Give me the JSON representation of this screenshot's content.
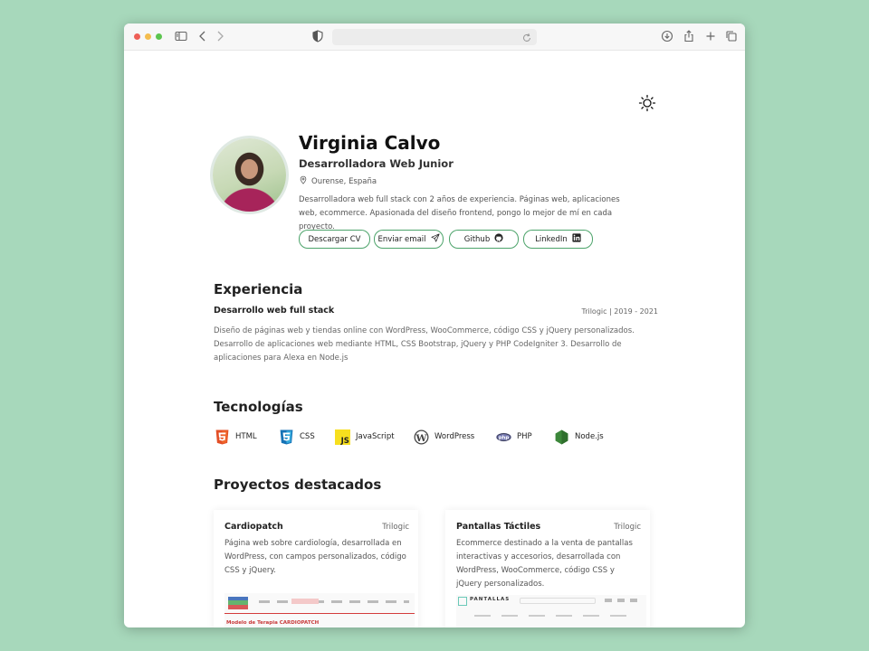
{
  "profile": {
    "name": "Virginia Calvo",
    "role": "Desarrolladora Web Junior",
    "location": "Ourense, España",
    "bio": "Desarrolladora web full stack con 2 años de experiencia. Páginas web, aplicaciones web, ecommerce. Apasionada del diseño frontend, pongo lo mejor de mí en cada proyecto."
  },
  "buttons": {
    "cv": "Descargar CV",
    "email": "Enviar email",
    "github": "Github",
    "linkedin": "LinkedIn"
  },
  "experience": {
    "heading": "Experiencia",
    "jobs": [
      {
        "title": "Desarrollo web full stack",
        "meta": "Trilogic | 2019 - 2021",
        "description": "Diseño de páginas web y tiendas online con WordPress, WooCommerce, código CSS y jQuery personalizados. Desarrollo de aplicaciones web mediante HTML, CSS Bootstrap, jQuery y PHP CodeIgniter 3. Desarrollo de aplicaciones para Alexa en Node.js"
      }
    ]
  },
  "technologies": {
    "heading": "Tecnologías",
    "items": [
      {
        "label": "HTML",
        "icon": "html5-icon",
        "color": "#e34f26"
      },
      {
        "label": "CSS",
        "icon": "css3-icon",
        "color": "#1572b6"
      },
      {
        "label": "JavaScript",
        "icon": "javascript-icon",
        "color": "#f7df1e"
      },
      {
        "label": "WordPress",
        "icon": "wordpress-icon",
        "color": "#444444"
      },
      {
        "label": "PHP",
        "icon": "php-icon",
        "color": "#777bb4"
      },
      {
        "label": "Node.js",
        "icon": "nodejs-icon",
        "color": "#3c873a"
      }
    ]
  },
  "projects": {
    "heading": "Proyectos destacados",
    "items": [
      {
        "title": "Cardiopatch",
        "company": "Trilogic",
        "description": "Página web sobre cardiología, desarrollada en WordPress, con campos personalizados, código CSS y jQuery.",
        "shot_heading": "Modelo de Terapia CARDIOPATCH"
      },
      {
        "title": "Pantallas Táctiles",
        "company": "Trilogic",
        "description": "Ecommerce destinado a la venta de pantallas interactivas y accesorios, desarrollada con WordPress, WooCommerce, código CSS y jQuery personalizados.",
        "shot_logo": "PANTALLAS"
      }
    ]
  },
  "colors": {
    "accent": "#4ca36a",
    "background": "#a7d8bb"
  }
}
